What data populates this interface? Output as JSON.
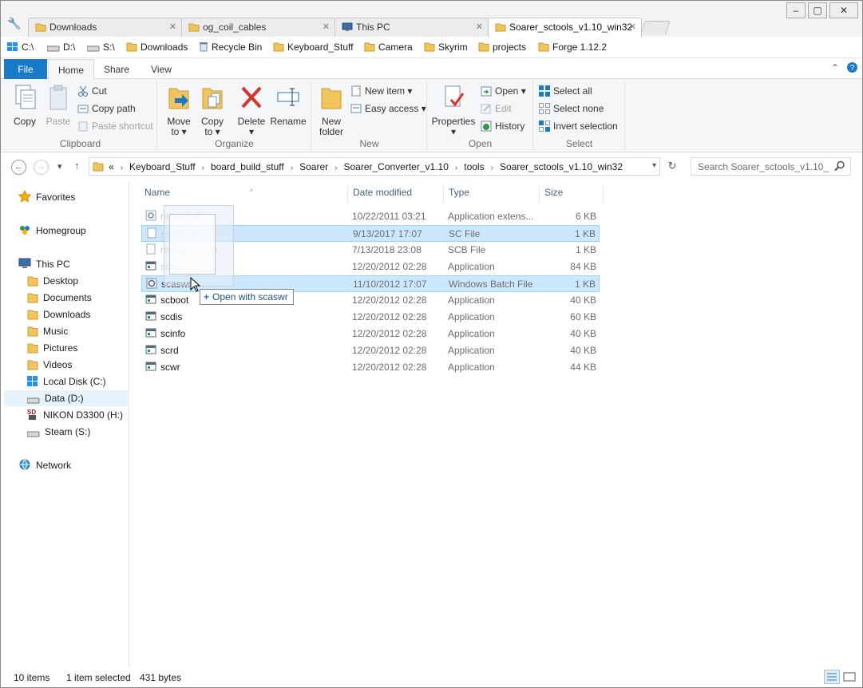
{
  "tabs": [
    {
      "label": "Downloads",
      "active": false
    },
    {
      "label": "og_coil_cables",
      "active": false
    },
    {
      "label": "This PC",
      "active": false
    },
    {
      "label": "Soarer_sctools_v1.10_win32",
      "active": true
    }
  ],
  "window_controls": {
    "minimize": "–",
    "maximize": "▢",
    "close": "✕"
  },
  "bookmarks": [
    "C:\\",
    "D:\\",
    "S:\\",
    "Downloads",
    "Recycle Bin",
    "Keyboard_Stuff",
    "Camera",
    "Skyrim",
    "projects",
    "Forge 1.12.2"
  ],
  "ribbon": {
    "tabs": [
      "File",
      "Home",
      "Share",
      "View"
    ],
    "clipboard": {
      "label": "Clipboard",
      "copy": "Copy",
      "paste": "Paste",
      "cut": "Cut",
      "copy_path": "Copy path",
      "paste_shortcut": "Paste shortcut"
    },
    "organize": {
      "label": "Organize",
      "move_to_1": "Move",
      "move_to_2": "to ▾",
      "copy_to_1": "Copy",
      "copy_to_2": "to ▾",
      "delete_1": "Delete",
      "delete_2": "▾",
      "rename": "Rename"
    },
    "new": {
      "label": "New",
      "new_folder_1": "New",
      "new_folder_2": "folder",
      "new_item": "New item ▾",
      "easy_access": "Easy access ▾"
    },
    "open": {
      "label": "Open",
      "properties_1": "Properties",
      "properties_2": "▾",
      "open": "Open ▾",
      "edit": "Edit",
      "history": "History"
    },
    "select": {
      "label": "Select",
      "select_all": "Select all",
      "select_none": "Select none",
      "invert": "Invert selection"
    }
  },
  "address": {
    "prefix": "«",
    "crumbs": [
      "Keyboard_Stuff",
      "board_build_stuff",
      "Soarer",
      "Soarer_Converter_v1.10",
      "tools",
      "Soarer_sctools_v1.10_win32"
    ]
  },
  "search": {
    "placeholder": "Search Soarer_sctools_v1.10_..."
  },
  "navpane": {
    "favorites": "Favorites",
    "homegroup": "Homegroup",
    "this_pc": "This PC",
    "pc_items": [
      "Desktop",
      "Documents",
      "Downloads",
      "Music",
      "Pictures",
      "Videos",
      "Local Disk (C:)",
      "Data (D:)",
      "NIKON D3300 (H:)",
      "Steam (S:)"
    ],
    "network": "Network"
  },
  "columns": {
    "name": "Name",
    "date": "Date modified",
    "type": "Type",
    "size": "Size"
  },
  "files": [
    {
      "name": "rawhid.dll",
      "date": "10/22/2011 03:21",
      "type": "Application extens...",
      "size": "6 KB",
      "icon": "dll",
      "selected": false,
      "ghost": true
    },
    {
      "name": "remap.sc",
      "date": "9/13/2017 17:07",
      "type": "SC File",
      "size": "1 KB",
      "icon": "doc",
      "selected": true,
      "ghost": true
    },
    {
      "name": "remap.sc.scb",
      "date": "7/13/2018 23:08",
      "type": "SCB File",
      "size": "1 KB",
      "icon": "doc",
      "selected": false,
      "ghost": true
    },
    {
      "name": "scas",
      "date": "12/20/2012 02:28",
      "type": "Application",
      "size": "84 KB",
      "icon": "app",
      "selected": false,
      "ghost": true
    },
    {
      "name": "scaswr",
      "date": "11/10/2012 17:07",
      "type": "Windows Batch File",
      "size": "1 KB",
      "icon": "bat",
      "selected": true,
      "ghost": false
    },
    {
      "name": "scboot",
      "date": "12/20/2012 02:28",
      "type": "Application",
      "size": "40 KB",
      "icon": "app",
      "selected": false,
      "ghost": false
    },
    {
      "name": "scdis",
      "date": "12/20/2012 02:28",
      "type": "Application",
      "size": "60 KB",
      "icon": "app",
      "selected": false,
      "ghost": false
    },
    {
      "name": "scinfo",
      "date": "12/20/2012 02:28",
      "type": "Application",
      "size": "40 KB",
      "icon": "app",
      "selected": false,
      "ghost": false
    },
    {
      "name": "scrd",
      "date": "12/20/2012 02:28",
      "type": "Application",
      "size": "40 KB",
      "icon": "app",
      "selected": false,
      "ghost": false
    },
    {
      "name": "scwr",
      "date": "12/20/2012 02:28",
      "type": "Application",
      "size": "44 KB",
      "icon": "app",
      "selected": false,
      "ghost": false
    }
  ],
  "drag_tooltip": "Open with scaswr",
  "status": {
    "items": "10 items",
    "selected": "1 item selected",
    "bytes": "431 bytes"
  },
  "colors": {
    "accent": "#1979ca",
    "selection": "#cce8ff",
    "selection_border": "#99d1ff",
    "folder": "#f2c55c"
  }
}
